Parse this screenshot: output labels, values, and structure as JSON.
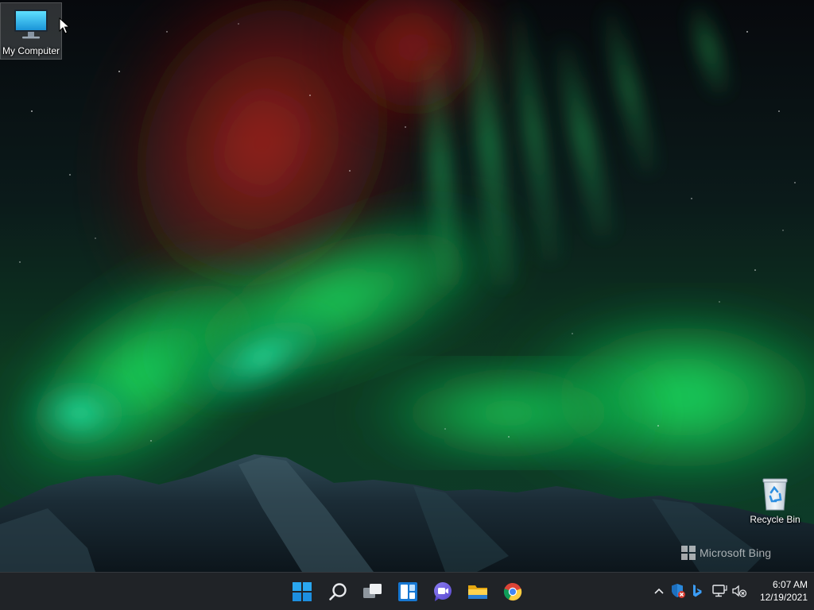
{
  "desktop": {
    "icons": [
      {
        "label": "My Computer",
        "icon": "monitor-icon"
      },
      {
        "label": "Recycle Bin",
        "icon": "recycle-bin-icon"
      }
    ],
    "watermark": {
      "text": "Microsoft Bing",
      "icon": "microsoft-logo-icon"
    },
    "wallpaper": "aurora-over-mountains"
  },
  "taskbar": {
    "pinned": [
      {
        "name": "start",
        "icon": "windows-logo-icon"
      },
      {
        "name": "search",
        "icon": "search-icon"
      },
      {
        "name": "task-view",
        "icon": "task-view-icon"
      },
      {
        "name": "widgets",
        "icon": "widgets-icon"
      },
      {
        "name": "chat",
        "icon": "chat-icon"
      },
      {
        "name": "file-explorer",
        "icon": "folder-icon"
      },
      {
        "name": "chrome",
        "icon": "chrome-icon"
      }
    ],
    "tray": [
      {
        "name": "show-hidden-icons",
        "icon": "chevron-up-icon"
      },
      {
        "name": "windows-security",
        "icon": "shield-icon"
      },
      {
        "name": "bing",
        "icon": "bing-icon"
      },
      {
        "name": "network",
        "icon": "network-icon"
      },
      {
        "name": "volume",
        "icon": "speaker-muted-icon"
      }
    ],
    "clock": {
      "time": "6:07 AM",
      "date": "12/19/2021"
    }
  },
  "colors": {
    "taskbar_bg": "#202327",
    "windows_blue": "#1a8ae6",
    "aurora_green": "#1fe06a",
    "aurora_red": "#b3261e"
  }
}
